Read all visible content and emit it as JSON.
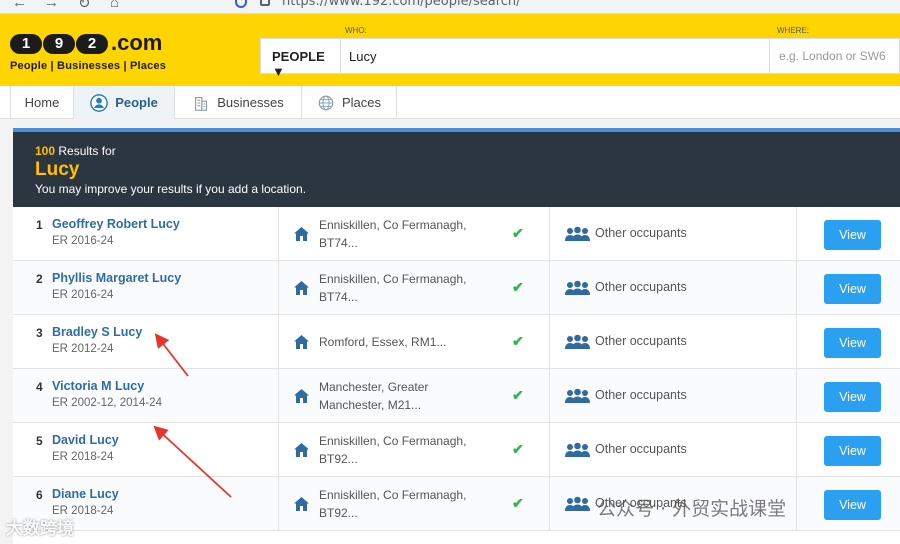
{
  "browser": {
    "url": "https://www.192.com/people/search/"
  },
  "brand": {
    "digits": [
      "1",
      "9",
      "2"
    ],
    "suffix": ".com",
    "tagline": "People | Businesses | Places",
    "color": "#ffd500"
  },
  "search": {
    "who_label": "WHO:",
    "where_label": "WHERE:",
    "type": "PEOPLE ▼",
    "query": "Lucy",
    "where_placeholder": "e.g. London or SW6"
  },
  "tabs": [
    {
      "label": "Home"
    },
    {
      "label": "People"
    },
    {
      "label": "Businesses"
    },
    {
      "label": "Places"
    }
  ],
  "results": {
    "count": "100",
    "count_suffix": "Results for",
    "query": "Lucy",
    "note": "You may improve your results if you add a location.",
    "rows": [
      {
        "rank": "1",
        "name": "Geoffrey Robert Lucy",
        "er": "ER 2016-24",
        "addr1": "Enniskillen, Co Fermanagh,",
        "addr2": "BT74...",
        "occupants": "Other occupants",
        "view": "View"
      },
      {
        "rank": "2",
        "name": "Phyllis Margaret Lucy",
        "er": "ER 2016-24",
        "addr1": "Enniskillen, Co Fermanagh,",
        "addr2": "BT74...",
        "occupants": "Other occupants",
        "view": "View"
      },
      {
        "rank": "3",
        "name": "Bradley S Lucy",
        "er": "ER 2012-24",
        "addr1": "Romford, Essex, RM1...",
        "addr2": "",
        "occupants": "Other occupants",
        "view": "View"
      },
      {
        "rank": "4",
        "name": "Victoria M Lucy",
        "er": "ER 2002-12, 2014-24",
        "addr1": "Manchester, Greater",
        "addr2": "Manchester, M21...",
        "occupants": "Other occupants",
        "view": "View"
      },
      {
        "rank": "5",
        "name": "David Lucy",
        "er": "ER 2018-24",
        "addr1": "Enniskillen, Co Fermanagh,",
        "addr2": "BT92...",
        "occupants": "Other occupants",
        "view": "View"
      },
      {
        "rank": "6",
        "name": "Diane Lucy",
        "er": "ER 2018-24",
        "addr1": "Enniskillen, Co Fermanagh,",
        "addr2": "BT92...",
        "occupants": "Other occupants",
        "view": "View"
      }
    ]
  },
  "watermark": {
    "text": "公众号 · 外贸实战课堂",
    "corner": "大数跨境"
  },
  "colors": {
    "accent": "#2b9ff0",
    "dark_panel": "#2c3641",
    "highlight": "#ffc000",
    "check": "#2db84d",
    "arrow": "#e8352b"
  }
}
